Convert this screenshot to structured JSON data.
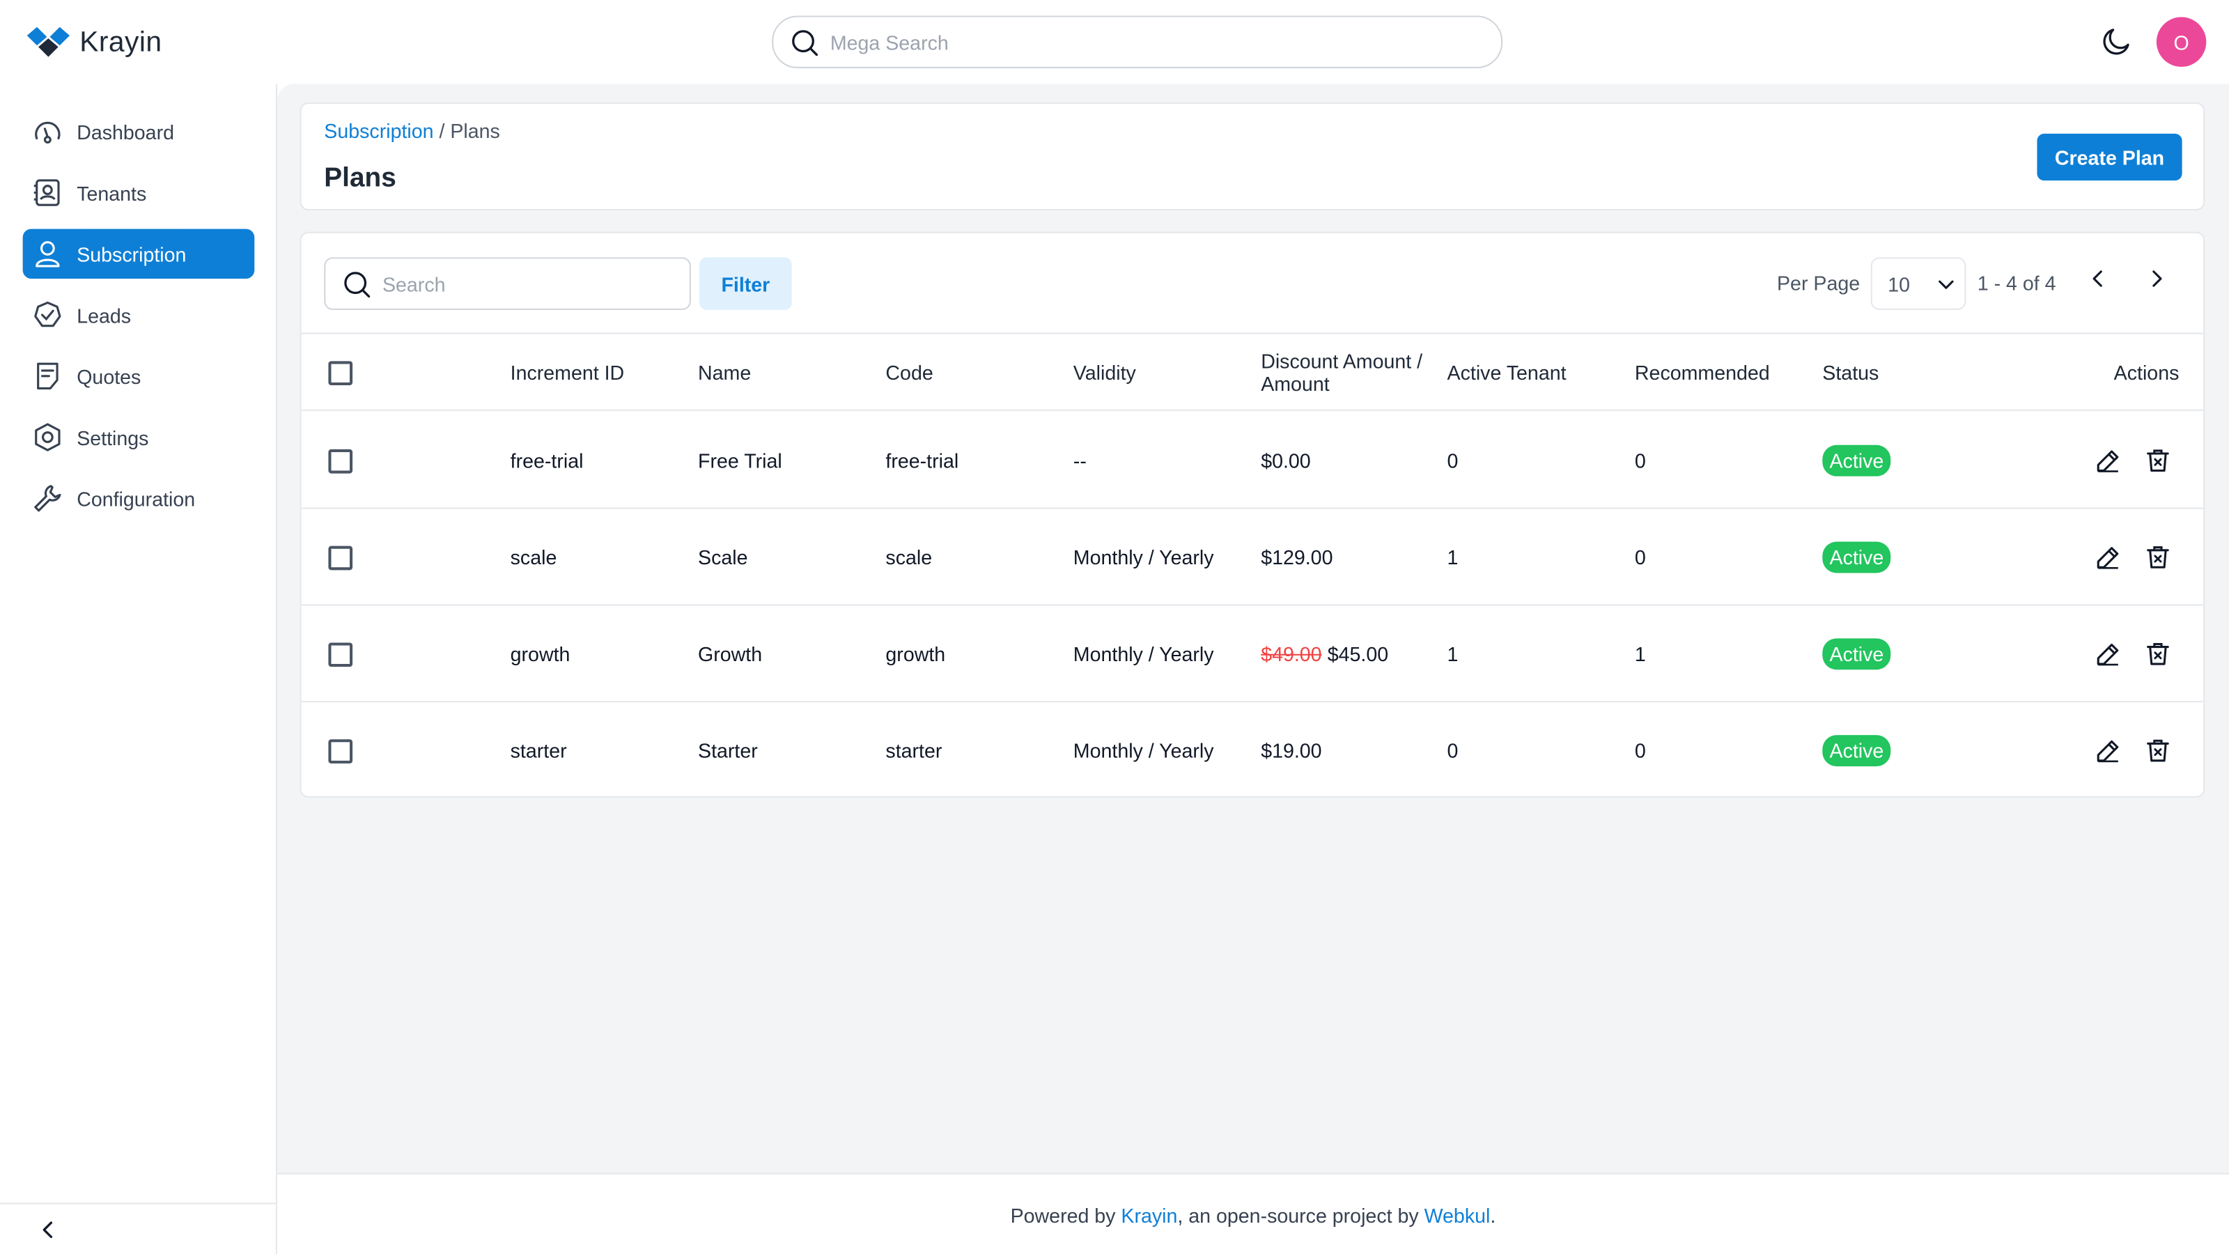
{
  "app": {
    "name": "Krayin"
  },
  "header": {
    "search_placeholder": "Mega Search",
    "avatar_initial": "O",
    "accent": "#0e7fd6",
    "avatar_color": "#ec4899"
  },
  "sidebar": {
    "items": [
      {
        "label": "Dashboard",
        "icon": "dashboard-icon",
        "active": false
      },
      {
        "label": "Tenants",
        "icon": "tenants-icon",
        "active": false
      },
      {
        "label": "Subscription",
        "icon": "user-icon",
        "active": true
      },
      {
        "label": "Leads",
        "icon": "leads-icon",
        "active": false
      },
      {
        "label": "Quotes",
        "icon": "quotes-icon",
        "active": false
      },
      {
        "label": "Settings",
        "icon": "settings-icon",
        "active": false
      },
      {
        "label": "Configuration",
        "icon": "wrench-icon",
        "active": false
      }
    ]
  },
  "page": {
    "breadcrumb_parent": "Subscription",
    "breadcrumb_separator": " / ",
    "breadcrumb_current": "Plans",
    "title": "Plans",
    "create_label": "Create Plan"
  },
  "toolbar": {
    "search_placeholder": "Search",
    "filter_label": "Filter",
    "per_page_label": "Per Page",
    "per_page_value": "10",
    "pager_info": "1 - 4 of 4"
  },
  "table": {
    "headers": {
      "increment_id": "Increment ID",
      "name": "Name",
      "code": "Code",
      "validity": "Validity",
      "amount": "Discount Amount / Amount",
      "active_tenant": "Active Tenant",
      "recommended": "Recommended",
      "status": "Status",
      "actions": "Actions"
    },
    "rows": [
      {
        "increment_id": "free-trial",
        "name": "Free Trial",
        "code": "free-trial",
        "validity": "--",
        "discount_amount": "",
        "amount": "$0.00",
        "active_tenant": "0",
        "recommended": "0",
        "status": "Active"
      },
      {
        "increment_id": "scale",
        "name": "Scale",
        "code": "scale",
        "validity": "Monthly / Yearly",
        "discount_amount": "",
        "amount": "$129.00",
        "active_tenant": "1",
        "recommended": "0",
        "status": "Active"
      },
      {
        "increment_id": "growth",
        "name": "Growth",
        "code": "growth",
        "validity": "Monthly / Yearly",
        "discount_amount": "$49.00",
        "amount": "$45.00",
        "active_tenant": "1",
        "recommended": "1",
        "status": "Active"
      },
      {
        "increment_id": "starter",
        "name": "Starter",
        "code": "starter",
        "validity": "Monthly / Yearly",
        "discount_amount": "",
        "amount": "$19.00",
        "active_tenant": "0",
        "recommended": "0",
        "status": "Active"
      }
    ],
    "status_color": "#22c55e",
    "discount_color": "#ef4444"
  },
  "footer": {
    "prefix": "Powered by ",
    "link1": "Krayin",
    "middle": ", an open-source project by ",
    "link2": "Webkul",
    "suffix": "."
  }
}
